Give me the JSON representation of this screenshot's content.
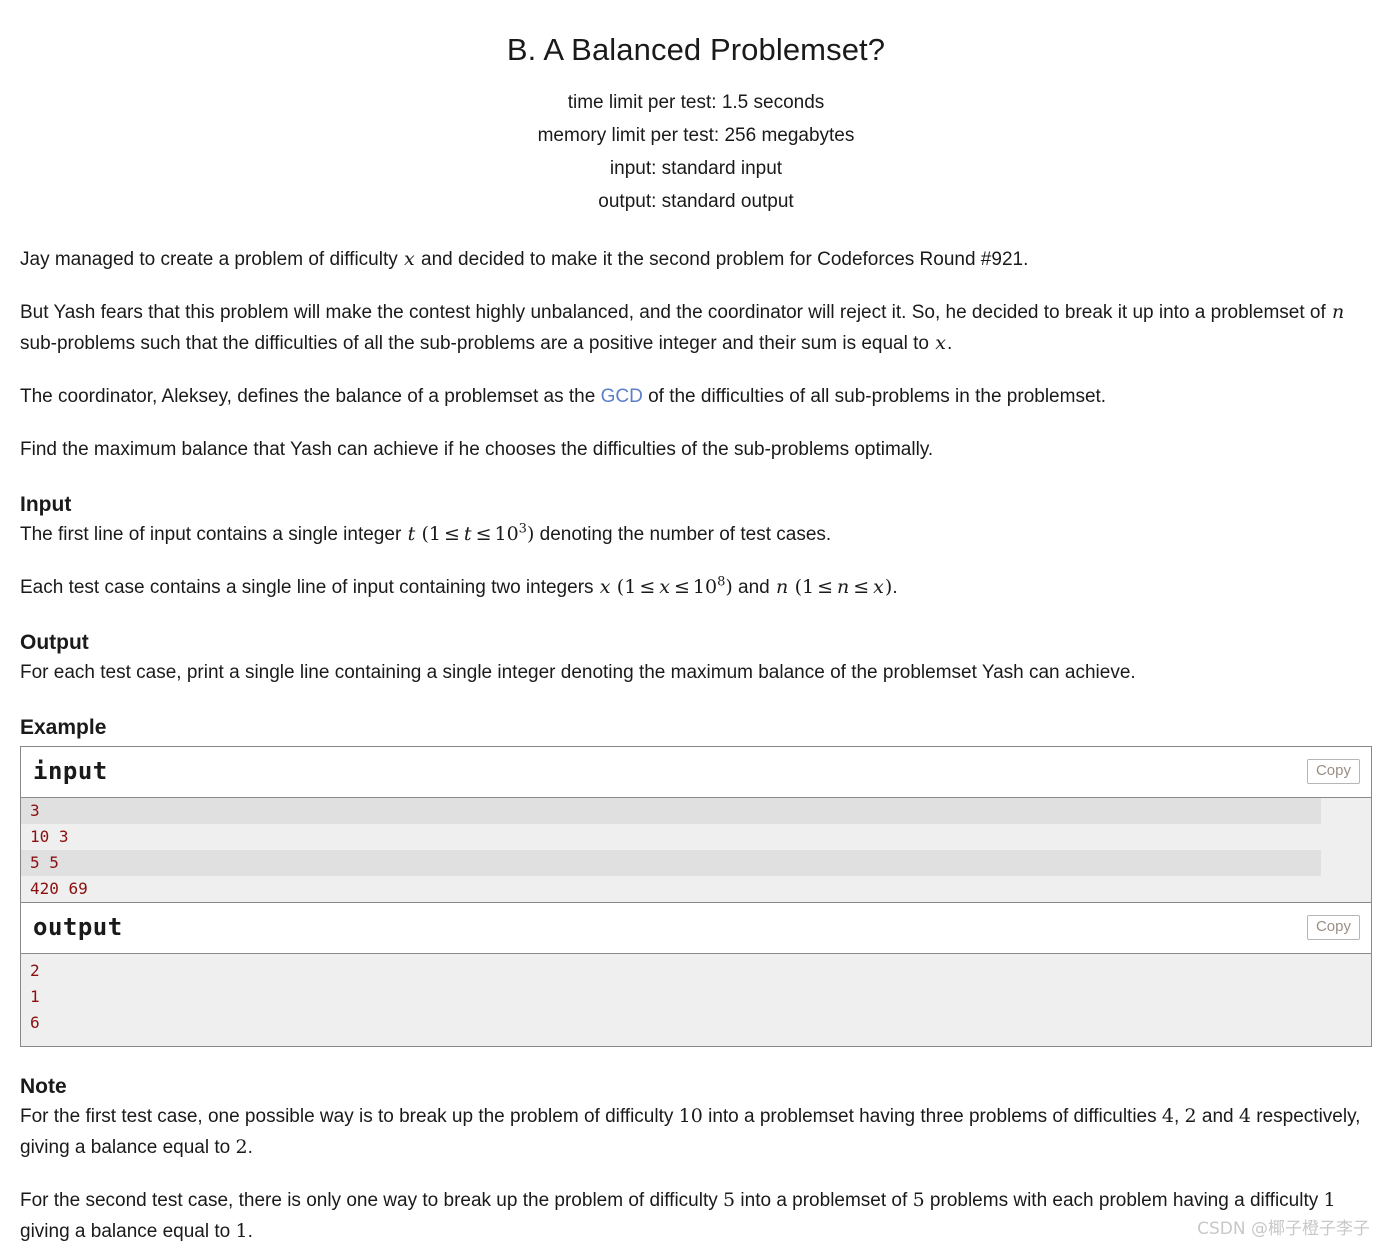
{
  "header": {
    "title": "B. A Balanced Problemset?",
    "time_limit": "time limit per test: 1.5 seconds",
    "memory_limit": "memory limit per test: 256 megabytes",
    "input_spec": "input: standard input",
    "output_spec": "output: standard output"
  },
  "statement": {
    "p1_a": "Jay managed to create a problem of difficulty ",
    "p1_var": "x",
    "p1_b": " and decided to make it the second problem for Codeforces Round #921.",
    "p2_a": "But Yash fears that this problem will make the contest highly unbalanced, and the coordinator will reject it. So, he decided to break it up into a problemset of ",
    "p2_var": "n",
    "p2_b": " sub-problems such that the difficulties of all the sub-problems are a positive integer and their sum is equal to ",
    "p2_var2": "x",
    "p2_c": ".",
    "p3_a": "The coordinator, Aleksey, defines the balance of a problemset as the ",
    "p3_link": "GCD",
    "p3_b": " of the difficulties of all sub-problems in the problemset.",
    "p4": "Find the maximum balance that Yash can achieve if he chooses the difficulties of the sub-problems optimally."
  },
  "input_section": {
    "heading": "Input",
    "l1_a": "The first line of input contains a single integer ",
    "l1_var": "t",
    "l1_open": "(",
    "l1_one": "1",
    "l1_le1": "≤",
    "l1_var2": "t",
    "l1_le2": "≤",
    "l1_base": "10",
    "l1_exp": "3",
    "l1_close": ")",
    "l1_b": " denoting the number of test cases.",
    "l2_a": "Each test case contains a single line of input containing two integers ",
    "l2_varx": "x",
    "l2_open": "(",
    "l2_one": "1",
    "l2_le1": "≤",
    "l2_varx2": "x",
    "l2_le2": "≤",
    "l2_base": "10",
    "l2_exp": "8",
    "l2_close": ")",
    "l2_and": " and ",
    "l2_varn": "n",
    "l2_open2": "(",
    "l2_one2": "1",
    "l2_le3": "≤",
    "l2_varn2": "n",
    "l2_le4": "≤",
    "l2_varx3": "x",
    "l2_close2": ")",
    "l2_b": "."
  },
  "output_section": {
    "heading": "Output",
    "text": "For each test case, print a single line containing a single integer denoting the maximum balance of the problemset Yash can achieve."
  },
  "example": {
    "heading": "Example",
    "input_label": "input",
    "output_label": "output",
    "copy_label": "Copy",
    "input_lines": [
      "3",
      "10 3",
      "5 5",
      "420 69"
    ],
    "output_lines": [
      "2",
      "1",
      "6"
    ]
  },
  "note_section": {
    "heading": "Note",
    "n1_a": "For the first test case, one possible way is to break up the problem of difficulty ",
    "n1_num1": "10",
    "n1_b": " into a problemset having three problems of difficulties ",
    "n1_num2": "4",
    "n1_c": ", ",
    "n1_num3": "2",
    "n1_d": " and ",
    "n1_num4": "4",
    "n1_e": " respectively, giving a balance equal to ",
    "n1_num5": "2",
    "n1_f": ".",
    "n2_a": "For the second test case, there is only one way to break up the problem of difficulty ",
    "n2_num1": "5",
    "n2_b": " into a problemset of ",
    "n2_num2": "5",
    "n2_c": " problems with each problem having a difficulty ",
    "n2_num3": "1",
    "n2_d": " giving a balance equal to ",
    "n2_num4": "1",
    "n2_e": "."
  },
  "watermark": {
    "text": "CSDN @椰子橙子李子"
  },
  "colors": {
    "link": "#5b7fc7",
    "code_text": "#8b0f0f",
    "stripe_dark": "#e0e0e0",
    "stripe_light": "#efefef",
    "border": "#888888",
    "copy_text": "#9b8f84"
  }
}
